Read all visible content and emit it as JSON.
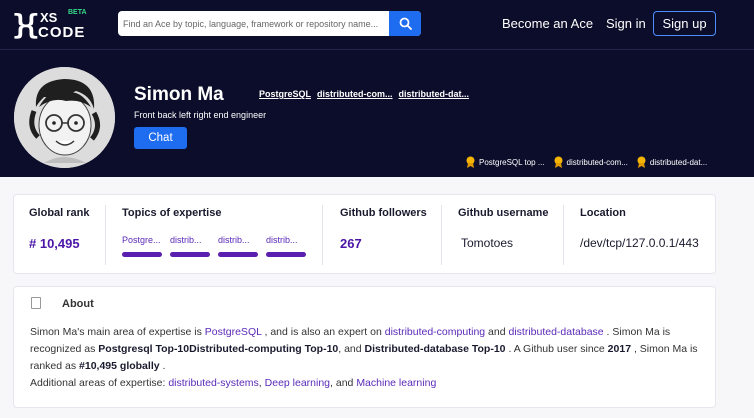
{
  "header": {
    "logo": {
      "mark": "}{",
      "xs": "XS",
      "code": "CODE",
      "beta": "BETA"
    },
    "search": {
      "placeholder": "Find an Ace by topic, language, framework or repository name..."
    },
    "nav": {
      "become_ace": "Become an Ace",
      "sign_in": "Sign in",
      "sign_up": "Sign up"
    }
  },
  "profile": {
    "name": "Simon Ma",
    "tagline": "Front back left right end engineer",
    "tags": [
      "PostgreSQL",
      "distributed-com...",
      "distributed-dat..."
    ],
    "chat_label": "Chat",
    "badges": [
      "PostgreSQL top ...",
      "distributed-com...",
      "distributed-dat..."
    ]
  },
  "stats": {
    "global_rank_label": "Global rank",
    "global_rank_value": "# 10,495",
    "topics_label": "Topics of expertise",
    "topics": [
      "Postgre...",
      "distrib...",
      "distrib...",
      "distrib..."
    ],
    "followers_label": "Github followers",
    "followers_value": "267",
    "username_label": "Github username",
    "username_value": "Tomotoes",
    "location_label": "Location",
    "location_value": "/dev/tcp/127.0.0.1/443"
  },
  "about": {
    "title": "About",
    "p1": "Simon Ma's main area of expertise is ",
    "t1": "PostgreSQL",
    "p2": " , and is also an expert on ",
    "t2": "distributed-computing",
    "p3": " and ",
    "t3": "distributed-database",
    "p4": " . Simon Ma is recognized as ",
    "b1": "Postgresql Top-10Distributed-computing Top-10",
    "p5": ", and ",
    "b2": "Distributed-database Top-10",
    "p6": " . A Github user since ",
    "b3": "2017",
    "p7": " , Simon Ma is ranked as ",
    "b4": "#10,495 globally",
    "p8": " .",
    "p9": "Additional areas of expertise: ",
    "t4": "distributed-systems",
    "p10": ", ",
    "t5": "Deep learning",
    "p11": ", and ",
    "t6": "Machine learning"
  },
  "colors": {
    "header_bg": "#0b0d2a",
    "accent_blue": "#1e6cf0",
    "accent_purple": "#5b2ab8",
    "badge_gold": "#f5b400"
  },
  "icons": [
    "search-icon",
    "medal-icon",
    "document-icon"
  ]
}
